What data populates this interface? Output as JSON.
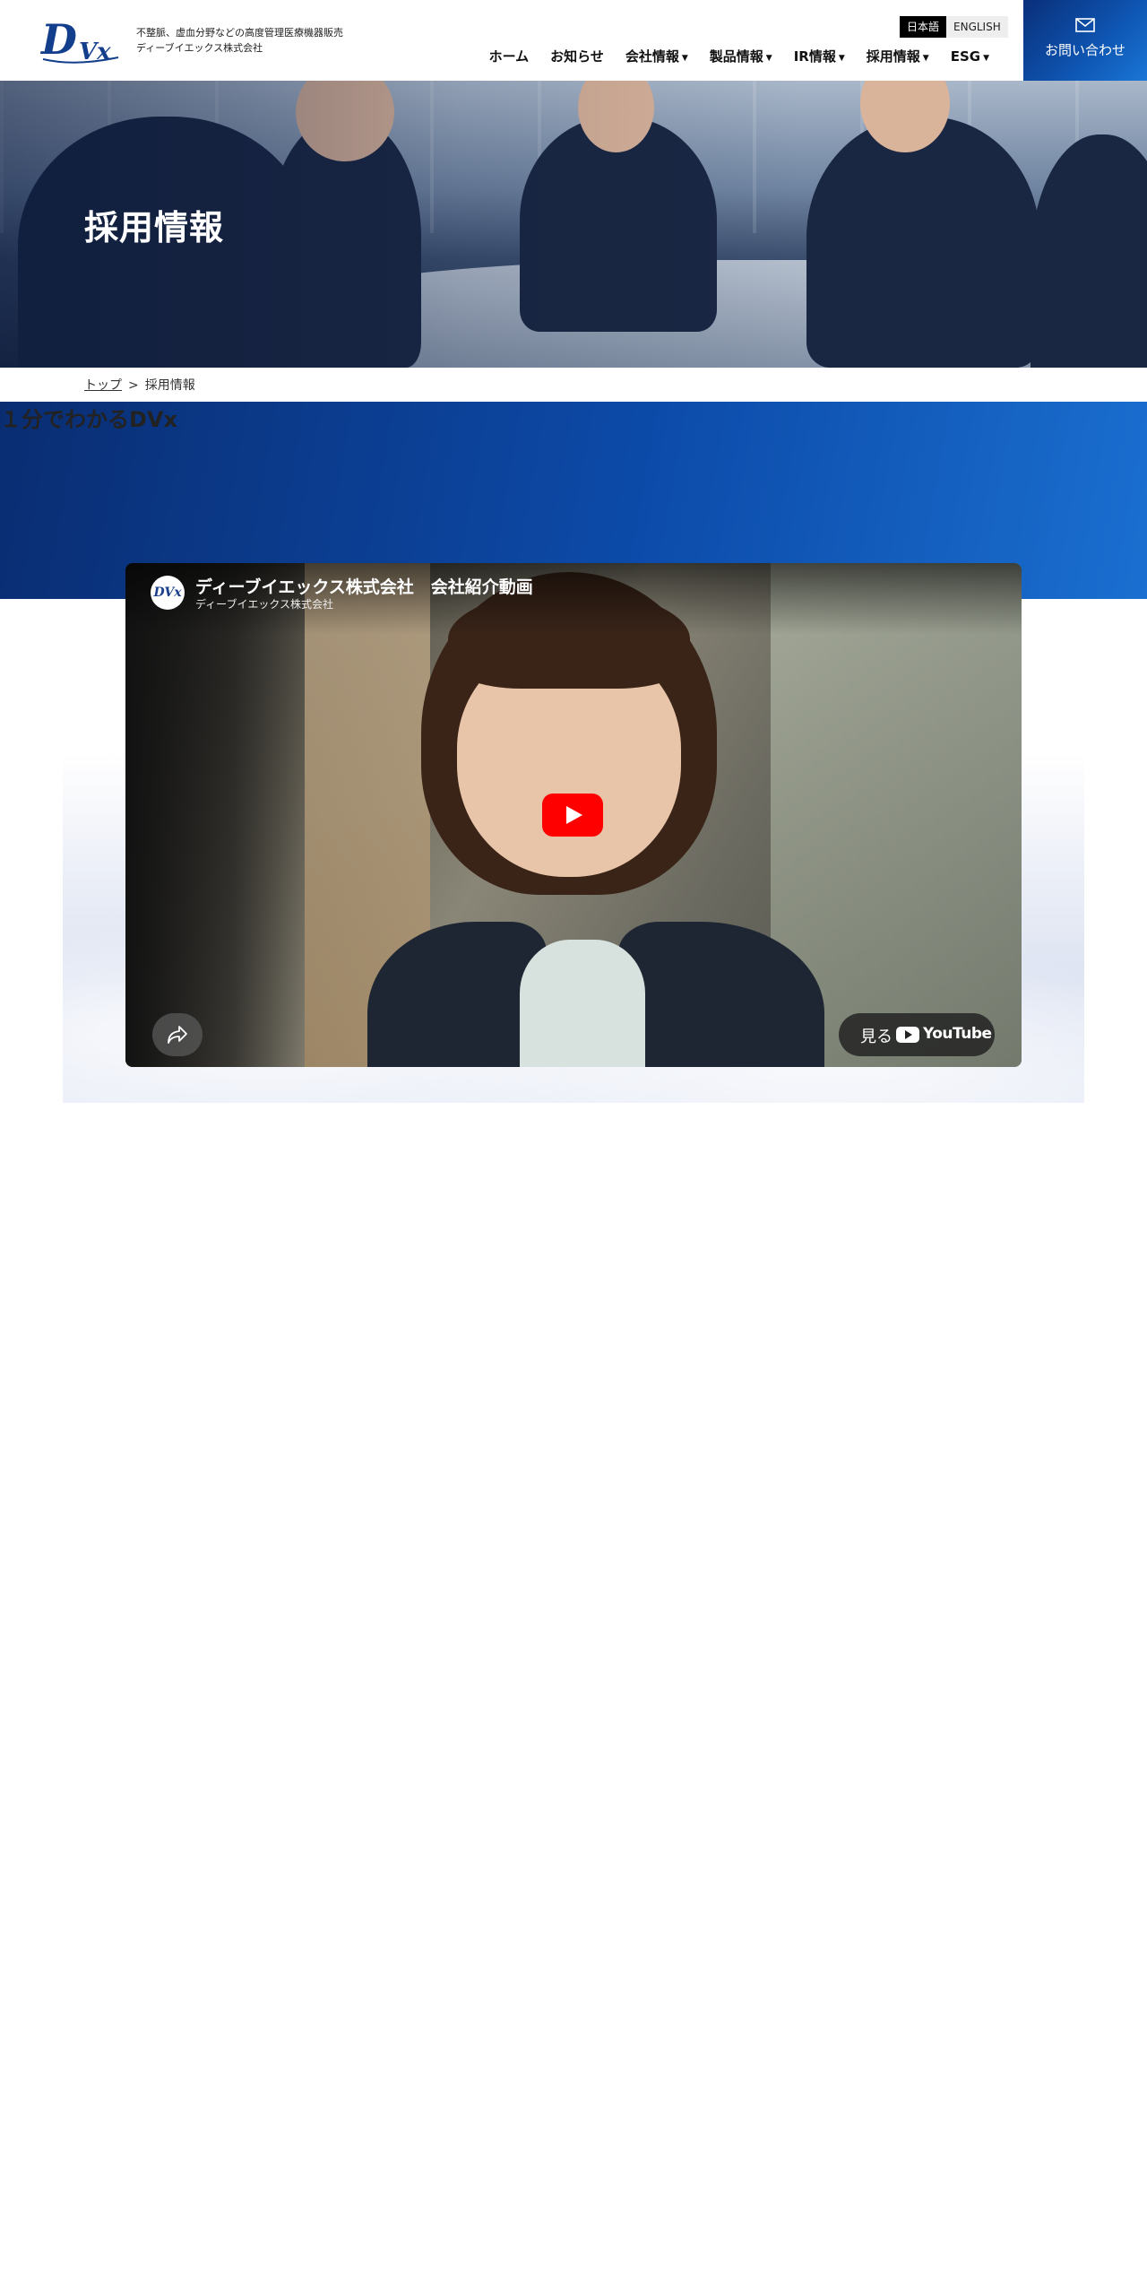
{
  "header": {
    "tagline_line1": "不整脈、虚血分野などの高度管理医療機器販売",
    "tagline_line2": "ディーブイエックス株式会社",
    "logo_text": "DVx",
    "lang_active": "日本語",
    "lang_other": "ENGLISH",
    "nav": [
      {
        "label": "ホーム",
        "has_dropdown": false
      },
      {
        "label": "お知らせ",
        "has_dropdown": false
      },
      {
        "label": "会社情報",
        "has_dropdown": true
      },
      {
        "label": "製品情報",
        "has_dropdown": true
      },
      {
        "label": "IR情報",
        "has_dropdown": true
      },
      {
        "label": "採用情報",
        "has_dropdown": true
      },
      {
        "label": "ESG",
        "has_dropdown": true
      }
    ],
    "contact_label": "お問い合わせ",
    "contact_icon": "mail-icon",
    "caret_glyph": "▼",
    "accent_color": "#0e56b3"
  },
  "hero": {
    "title": "採用情報"
  },
  "breadcrumb": {
    "home": "トップ",
    "separator": ">",
    "current": "採用情報"
  },
  "section": {
    "title": "１分でわかるDVx"
  },
  "video": {
    "title": "ディーブイエックス株式会社　会社紹介動画",
    "channel": "ディーブイエックス株式会社",
    "avatar_text": "DVx",
    "watch_label": "見る",
    "youtube_word": "YouTube",
    "share_icon": "share-icon",
    "play_icon": "play-icon"
  }
}
